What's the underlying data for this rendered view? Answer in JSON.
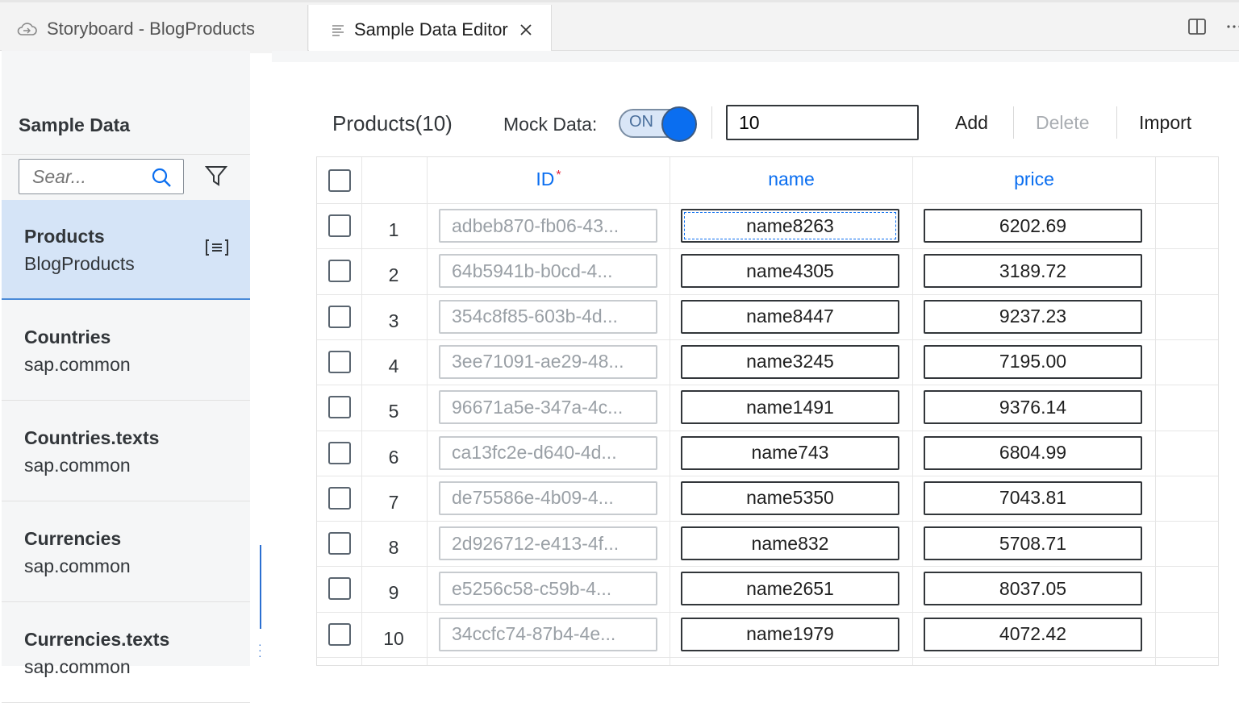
{
  "tabs": [
    {
      "label": "Storyboard - BlogProducts",
      "icon": "cloud-icon"
    },
    {
      "label": "Sample Data Editor",
      "icon": "file-lines-icon",
      "active": true
    }
  ],
  "sidebar": {
    "title": "Sample Data",
    "search_placeholder": "Sear...",
    "entities": [
      {
        "name": "Products",
        "namespace": "BlogProducts",
        "selected": true
      },
      {
        "name": "Countries",
        "namespace": "sap.common"
      },
      {
        "name": "Countries.texts",
        "namespace": "sap.common"
      },
      {
        "name": "Currencies",
        "namespace": "sap.common"
      },
      {
        "name": "Currencies.texts",
        "namespace": "sap.common"
      }
    ]
  },
  "toolbar": {
    "title": "Products(10)",
    "mock_label": "Mock Data:",
    "switch_label": "ON",
    "count_value": "10",
    "add_label": "Add",
    "delete_label": "Delete",
    "import_label": "Import"
  },
  "table": {
    "columns": [
      "ID",
      "name",
      "price"
    ],
    "rows": [
      {
        "num": "1",
        "id": "adbeb870-fb06-43...",
        "name": "name8263",
        "price": "6202.69"
      },
      {
        "num": "2",
        "id": "64b5941b-b0cd-4...",
        "name": "name4305",
        "price": "3189.72"
      },
      {
        "num": "3",
        "id": "354c8f85-603b-4d...",
        "name": "name8447",
        "price": "9237.23"
      },
      {
        "num": "4",
        "id": "3ee71091-ae29-48...",
        "name": "name3245",
        "price": "7195.00"
      },
      {
        "num": "5",
        "id": "96671a5e-347a-4c...",
        "name": "name1491",
        "price": "9376.14"
      },
      {
        "num": "6",
        "id": "ca13fc2e-d640-4d...",
        "name": "name743",
        "price": "6804.99"
      },
      {
        "num": "7",
        "id": "de75586e-4b09-4...",
        "name": "name5350",
        "price": "7043.81"
      },
      {
        "num": "8",
        "id": "2d926712-e413-4f...",
        "name": "name832",
        "price": "5708.71"
      },
      {
        "num": "9",
        "id": "e5256c58-c59b-4...",
        "name": "name2651",
        "price": "8037.05"
      },
      {
        "num": "10",
        "id": "34ccfc74-87b4-4e...",
        "name": "name1979",
        "price": "4072.42"
      }
    ]
  },
  "colors": {
    "accent": "#0a6ef0",
    "selected_bg": "#d5e4f7",
    "required": "#e5243b"
  }
}
